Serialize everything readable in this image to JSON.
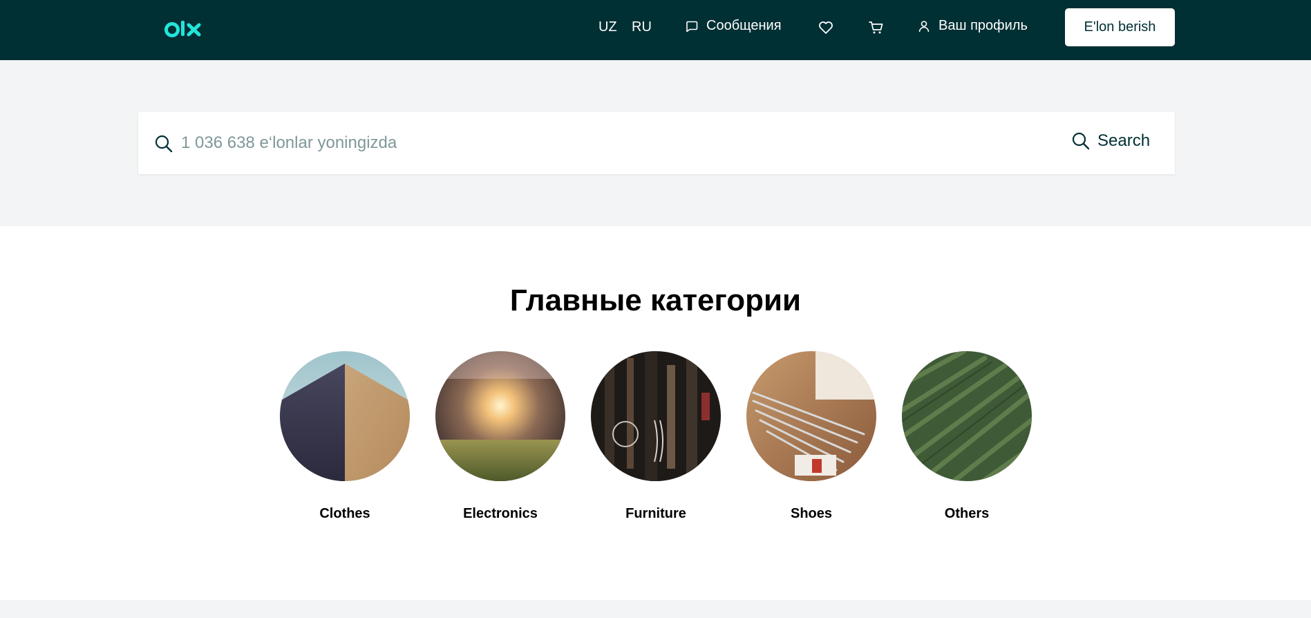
{
  "header": {
    "logo_text": "olx",
    "lang_uz": "UZ",
    "lang_ru": "RU",
    "messages_label": "Сообщения",
    "profile_label": "Ваш профиль",
    "post_button_label": "E'lon berish",
    "icons": [
      "chat-icon",
      "heart-icon",
      "cart-icon",
      "user-icon"
    ]
  },
  "search": {
    "placeholder": "1 036 638 e‘lonlar yoningizda",
    "value": "",
    "button_label": "Search"
  },
  "categories": {
    "title": "Главные категории",
    "items": [
      {
        "label": "Clothes",
        "image": "sand-dune-photo"
      },
      {
        "label": "Electronics",
        "image": "sunset-grass-photo"
      },
      {
        "label": "Furniture",
        "image": "hanging-tools-photo"
      },
      {
        "label": "Shoes",
        "image": "knitting-needles-photo"
      },
      {
        "label": "Others",
        "image": "green-field-aerial-photo"
      }
    ]
  },
  "colors": {
    "header_bg": "#002f34",
    "brand_accent": "#23e5db",
    "band_bg": "#f2f4f5"
  }
}
